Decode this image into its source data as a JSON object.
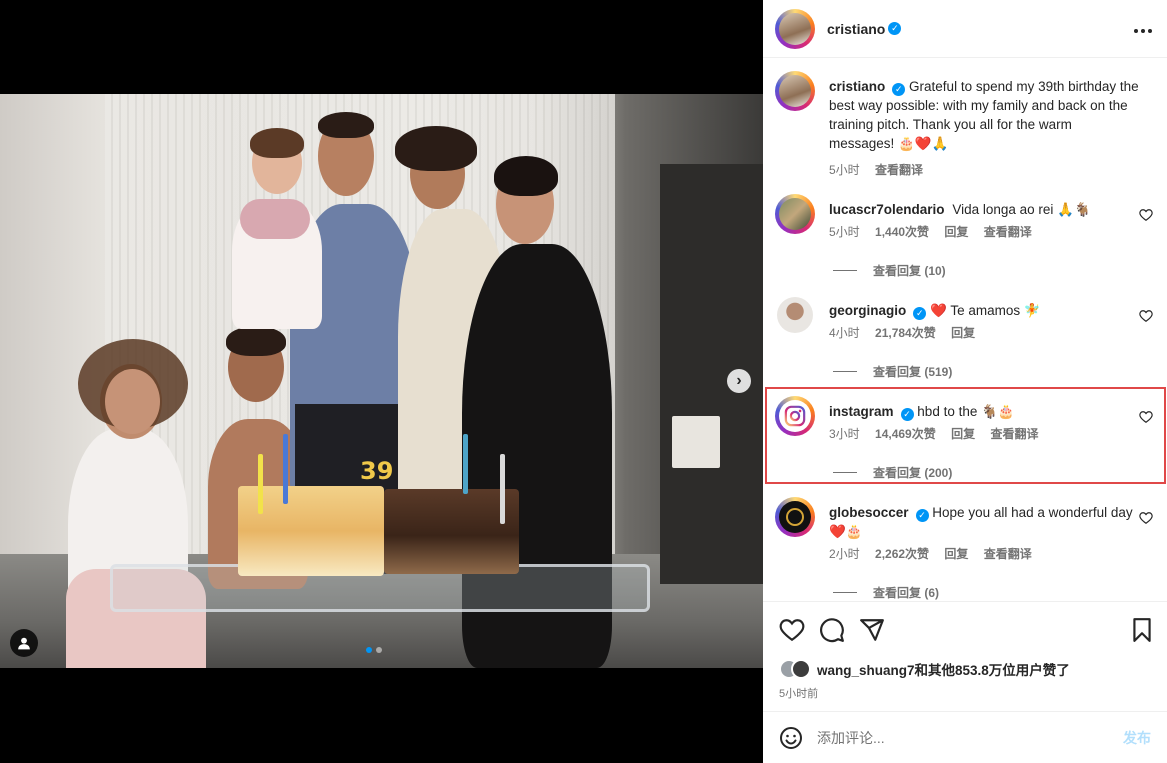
{
  "post": {
    "author": "cristiano",
    "caption": {
      "user": "cristiano",
      "text": "Grateful to spend my 39th birthday the best way possible: with my family and back on the training pitch. Thank you all for the warm messages! 🎂❤️🙏",
      "time": "5小时",
      "translate": "查看翻译"
    },
    "media": {
      "next_label": "›",
      "cake_number": "39",
      "carousel_count": 2
    }
  },
  "comments": [
    {
      "user": "lucascr7olendario",
      "text": "Vida longa ao rei 🙏🐐",
      "time": "5小时",
      "likes": "1,440次赞",
      "reply": "回复",
      "translate": "查看翻译",
      "view_replies": "查看回复 (10)"
    },
    {
      "user": "georginagio",
      "text": "❤️ Te amamos 🧚",
      "time": "4小时",
      "likes": "21,784次赞",
      "reply": "回复",
      "view_replies": "查看回复 (519)"
    },
    {
      "user": "instagram",
      "text": "hbd to the 🐐🎂",
      "time": "3小时",
      "likes": "14,469次赞",
      "reply": "回复",
      "translate": "查看翻译",
      "view_replies": "查看回复 (200)"
    },
    {
      "user": "globesoccer",
      "text": "Hope you all had a wonderful day ❤️🎂",
      "time": "2小时",
      "likes": "2,262次赞",
      "reply": "回复",
      "translate": "查看翻译",
      "view_replies": "查看回复 (6)"
    }
  ],
  "likes_summary": "wang_shuang7和其他853.8万位用户赞了",
  "posted_time": "5小时前",
  "add_comment": {
    "placeholder": "添加评论...",
    "post_label": "发布"
  },
  "colors": {
    "accent": "#0095f6",
    "highlight_border": "#e04848",
    "heart_red": "#ed4956"
  },
  "icons": [
    "more-icon",
    "heart-icon",
    "comment-icon",
    "share-icon",
    "bookmark-icon",
    "emoji-icon",
    "user-tag-icon",
    "chevron-right-icon",
    "verified-icon"
  ]
}
